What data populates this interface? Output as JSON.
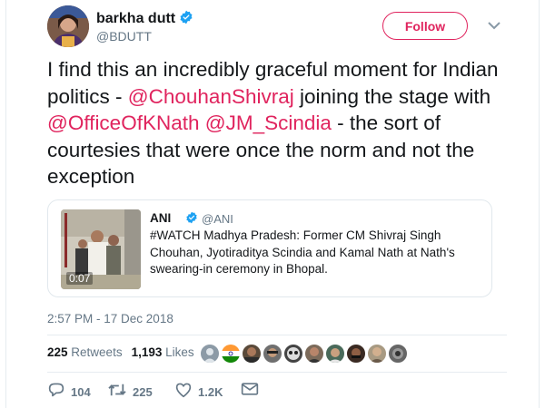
{
  "author": {
    "name": "barkha dutt",
    "handle": "@BDUTT",
    "verified": true
  },
  "follow_label": "Follow",
  "tweet": {
    "parts": [
      {
        "text": "I find this an incredibly graceful moment for Indian politics - ",
        "mention": false
      },
      {
        "text": "@ChouhanShivraj",
        "mention": true
      },
      {
        "text": " joining the stage with ",
        "mention": false
      },
      {
        "text": "@OfficeOfKNath",
        "mention": true
      },
      {
        "text": " ",
        "mention": false
      },
      {
        "text": "@JM_Scindia",
        "mention": true
      },
      {
        "text": " - the sort of courtesies that were once the norm and not the exception",
        "mention": false
      }
    ]
  },
  "quoted": {
    "name": "ANI",
    "handle": "@ANI",
    "verified": true,
    "text": "#WATCH Madhya Pradesh: Former CM Shivraj Singh Chouhan, Jyotiraditya Scindia and Kamal Nath at Nath's swearing-in ceremony in Bhopal.",
    "video_duration": "0:07"
  },
  "timestamp": "2:57 PM - 17 Dec 2018",
  "stats": {
    "retweets_count": "225",
    "retweets_label": "Retweets",
    "likes_count": "1,193",
    "likes_label": "Likes"
  },
  "actions": {
    "replies": "104",
    "retweets": "225",
    "likes": "1.2K"
  },
  "colors": {
    "accent": "#e0245e",
    "verified": "#1da1f2",
    "secondary_text": "#657786",
    "border": "#e1e8ed"
  },
  "icons": [
    "verified-badge-icon",
    "caret-down-icon",
    "reply-icon",
    "retweet-icon",
    "like-icon",
    "direct-message-icon"
  ]
}
